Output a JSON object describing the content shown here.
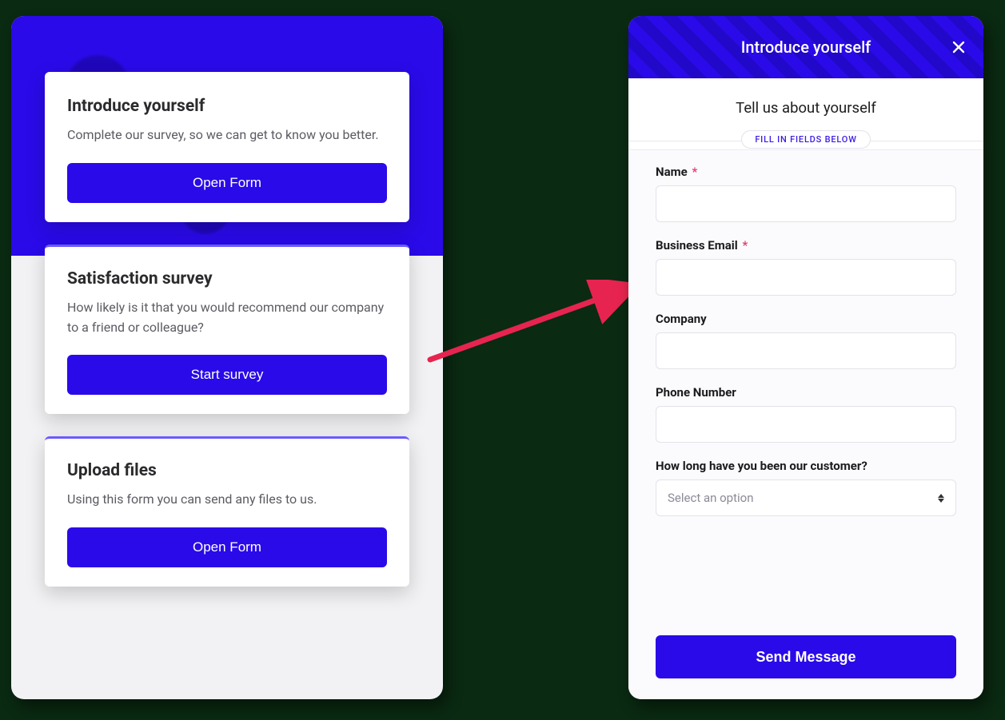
{
  "colors": {
    "primary": "#2a0ae8",
    "arrow": "#e6244f"
  },
  "left": {
    "cards": [
      {
        "title": "Introduce yourself",
        "desc": "Complete our survey, so we can get to know you better.",
        "button": "Open Form"
      },
      {
        "title": "Satisfaction survey",
        "desc": "How likely is it that you would recommend our company to a friend or colleague?",
        "button": "Start survey"
      },
      {
        "title": "Upload files",
        "desc": "Using this form you can send any files to us.",
        "button": "Open Form"
      }
    ]
  },
  "form": {
    "header_title": "Introduce yourself",
    "subtitle": "Tell us about yourself",
    "chip": "FILL IN FIELDS BELOW",
    "required_mark": "*",
    "fields": {
      "name_label": "Name",
      "email_label": "Business Email",
      "company_label": "Company",
      "phone_label": "Phone Number",
      "tenure_label": "How long have you been our customer?",
      "tenure_placeholder": "Select an option"
    },
    "submit": "Send Message"
  }
}
